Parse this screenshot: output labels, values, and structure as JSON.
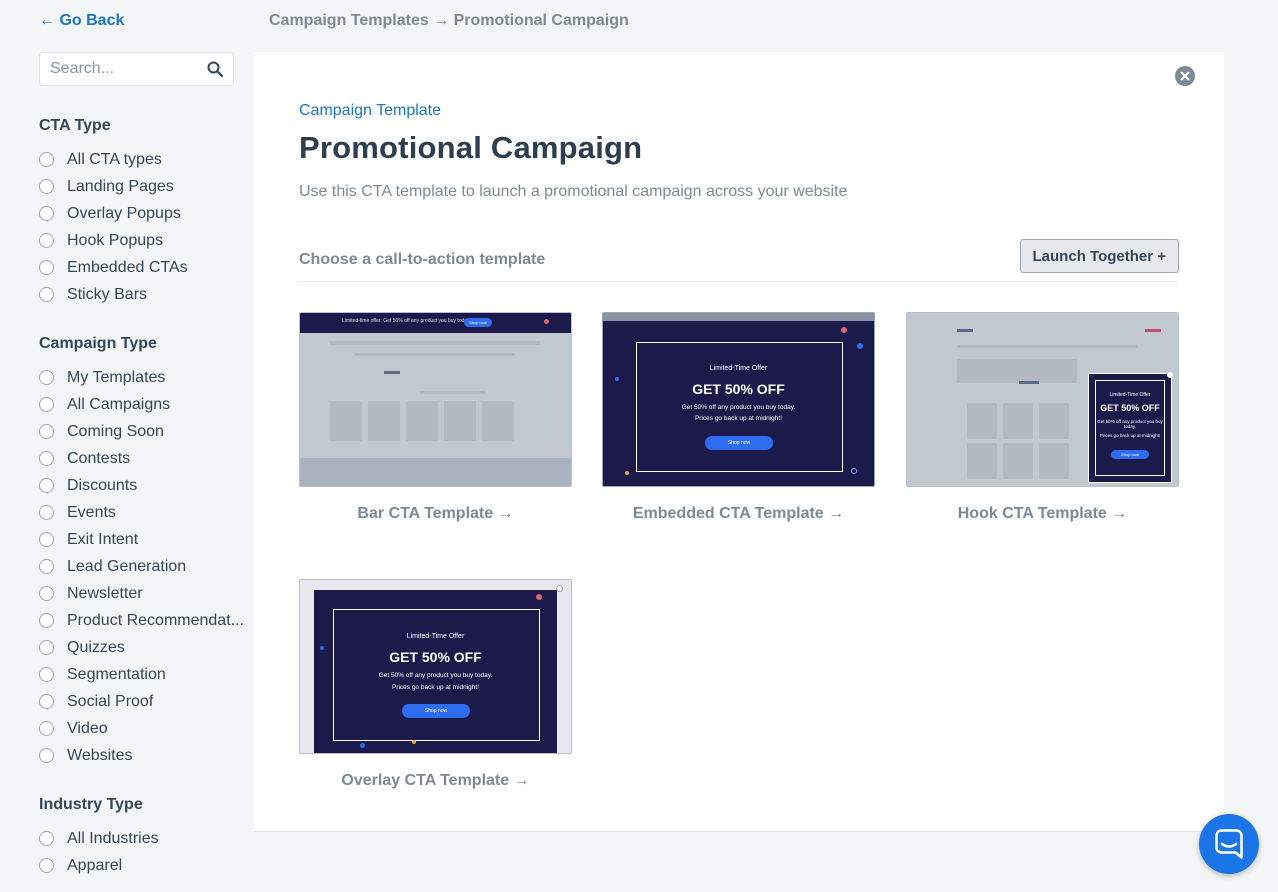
{
  "nav": {
    "back_label": "← Go Back",
    "breadcrumb": "Campaign Templates → Promotional Campaign"
  },
  "search": {
    "placeholder": "Search..."
  },
  "filters": {
    "cta_type": {
      "title": "CTA Type",
      "options": [
        "All CTA types",
        "Landing Pages",
        "Overlay Popups",
        "Hook Popups",
        "Embedded CTAs",
        "Sticky Bars"
      ]
    },
    "campaign_type": {
      "title": "Campaign Type",
      "options": [
        "My Templates",
        "All Campaigns",
        "Coming Soon",
        "Contests",
        "Discounts",
        "Events",
        "Exit Intent",
        "Lead Generation",
        "Newsletter",
        "Product Recommendat...",
        "Quizzes",
        "Segmentation",
        "Social Proof",
        "Video",
        "Websites"
      ]
    },
    "industry_type": {
      "title": "Industry Type",
      "options": [
        "All Industries",
        "Apparel"
      ]
    }
  },
  "main": {
    "eyebrow": "Campaign Template",
    "title": "Promotional Campaign",
    "description": "Use this CTA template to launch a promotional campaign across your website",
    "choose_label": "Choose a call-to-action template",
    "launch_label": "Launch Together +",
    "cards": [
      {
        "caption": "Bar CTA Template →"
      },
      {
        "caption": "Embedded CTA Template →"
      },
      {
        "caption": "Hook CTA Template →"
      },
      {
        "caption": "Overlay CTA Template →"
      }
    ],
    "preview": {
      "bar_text": "Limited-time offer: Get 50% off any product you buy today",
      "bar_button": "Shop now",
      "eyebrow": "Limited-Time Offer",
      "headline": "GET 50% OFF",
      "line1": "Get 50% off any product you buy today.",
      "line2": "Prices go back up at midnight!",
      "button": "Shop now"
    }
  },
  "colors": {
    "accent": "#1b75c9",
    "preview_bg": "#1b1a4a",
    "cta_button": "#2e6cf0"
  },
  "icons": {
    "search": "search-icon",
    "close": "close-icon",
    "messenger": "chat-icon"
  }
}
